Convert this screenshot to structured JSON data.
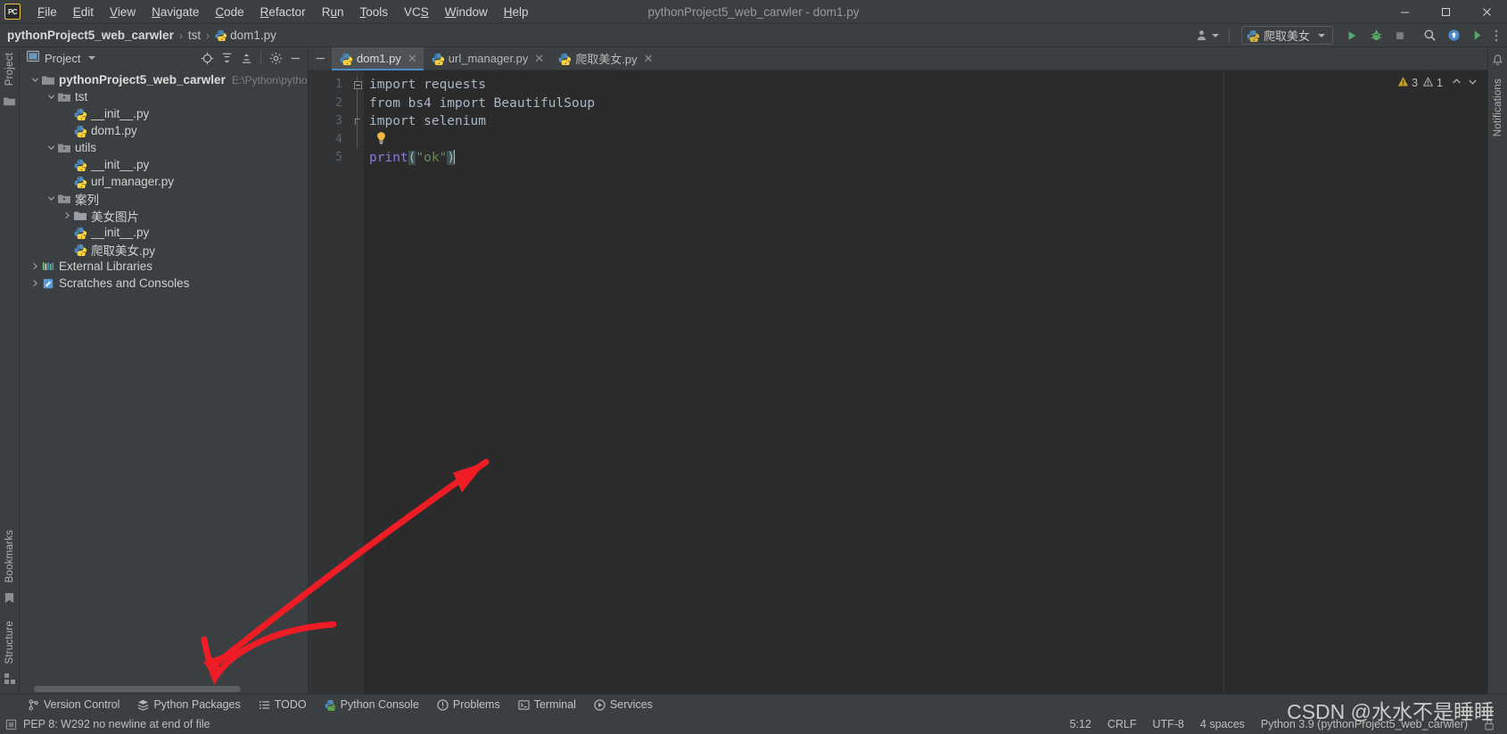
{
  "window": {
    "title": "pythonProject5_web_carwler - dom1.py",
    "app_logo": "pycharm-logo",
    "controls": {
      "minimize": "—",
      "maximize": "☐",
      "close": "✕"
    }
  },
  "menu": {
    "items": [
      {
        "label": "File",
        "mnemonic": "F"
      },
      {
        "label": "Edit",
        "mnemonic": "E"
      },
      {
        "label": "View",
        "mnemonic": "V"
      },
      {
        "label": "Navigate",
        "mnemonic": "N"
      },
      {
        "label": "Code",
        "mnemonic": "C"
      },
      {
        "label": "Refactor",
        "mnemonic": "R"
      },
      {
        "label": "Run",
        "mnemonic": "u"
      },
      {
        "label": "Tools",
        "mnemonic": "T"
      },
      {
        "label": "VCS",
        "mnemonic": "S"
      },
      {
        "label": "Window",
        "mnemonic": "W"
      },
      {
        "label": "Help",
        "mnemonic": "H"
      }
    ]
  },
  "breadcrumb": {
    "project": "pythonProject5_web_carwler",
    "folder": "tst",
    "file": "dom1.py",
    "separator": "›"
  },
  "toolbar": {
    "run_config": "爬取美女",
    "buttons": [
      {
        "name": "user-avatar-button",
        "tip": "Settings Sync"
      },
      {
        "name": "run-button",
        "tip": "Run"
      },
      {
        "name": "debug-button",
        "tip": "Debug"
      },
      {
        "name": "stop-button",
        "tip": "Stop"
      },
      {
        "name": "search-everywhere-button",
        "tip": "Search Everywhere"
      },
      {
        "name": "updates-button",
        "tip": "IDE Updates"
      },
      {
        "name": "hide-toolbar-button",
        "tip": "More"
      }
    ]
  },
  "left_rail": {
    "top_label": "Project",
    "bottom_labels": [
      "Bookmarks",
      "Structure"
    ]
  },
  "right_rail": {
    "label": "Notifications"
  },
  "project_panel": {
    "title": "Project",
    "tools": [
      "target-icon",
      "expand-all-icon",
      "collapse-all-icon",
      "gear-icon",
      "hide-icon"
    ],
    "tree": [
      {
        "depth": 0,
        "arrow": "down",
        "icon": "folder-project",
        "label": "pythonProject5_web_carwler",
        "bold": true,
        "path": "E:\\Python\\pythonPr"
      },
      {
        "depth": 1,
        "arrow": "down",
        "icon": "folder-source",
        "label": "tst",
        "bold": false,
        "path": ""
      },
      {
        "depth": 2,
        "arrow": "none",
        "icon": "python-file",
        "label": "__init__.py",
        "bold": false,
        "path": ""
      },
      {
        "depth": 2,
        "arrow": "none",
        "icon": "python-file",
        "label": "dom1.py",
        "bold": false,
        "path": ""
      },
      {
        "depth": 1,
        "arrow": "down",
        "icon": "folder-source",
        "label": "utils",
        "bold": false,
        "path": ""
      },
      {
        "depth": 2,
        "arrow": "none",
        "icon": "python-file",
        "label": "__init__.py",
        "bold": false,
        "path": ""
      },
      {
        "depth": 2,
        "arrow": "none",
        "icon": "python-file",
        "label": "url_manager.py",
        "bold": false,
        "path": ""
      },
      {
        "depth": 1,
        "arrow": "down",
        "icon": "folder-source",
        "label": "案列",
        "bold": false,
        "path": ""
      },
      {
        "depth": 2,
        "arrow": "right",
        "icon": "folder-plain",
        "label": "美女图片",
        "bold": false,
        "path": ""
      },
      {
        "depth": 2,
        "arrow": "none",
        "icon": "python-file",
        "label": "__init__.py",
        "bold": false,
        "path": ""
      },
      {
        "depth": 2,
        "arrow": "none",
        "icon": "python-file",
        "label": "爬取美女.py",
        "bold": false,
        "path": ""
      },
      {
        "depth": 0,
        "arrow": "right",
        "icon": "libraries",
        "label": "External Libraries",
        "bold": false,
        "path": ""
      },
      {
        "depth": 0,
        "arrow": "right",
        "icon": "scratches",
        "label": "Scratches and Consoles",
        "bold": false,
        "path": ""
      }
    ]
  },
  "editor": {
    "tabs": [
      {
        "label": "dom1.py",
        "active": true,
        "icon": "python-file",
        "close": "✕"
      },
      {
        "label": "url_manager.py",
        "active": false,
        "icon": "python-file",
        "close": "✕"
      },
      {
        "label": "爬取美女.py",
        "active": false,
        "icon": "python-file",
        "close": "✕"
      }
    ],
    "line_numbers": [
      "1",
      "2",
      "3",
      "4",
      "5"
    ],
    "lines": [
      {
        "n": 1,
        "fold": "collapse",
        "tokens": [
          {
            "t": "import requests",
            "c": "plain"
          }
        ]
      },
      {
        "n": 2,
        "fold": "none",
        "tokens": [
          {
            "t": "from bs4 import BeautifulSoup",
            "c": "plain"
          }
        ]
      },
      {
        "n": 3,
        "fold": "end",
        "tokens": [
          {
            "t": "import selenium",
            "c": "plain"
          }
        ]
      },
      {
        "n": 4,
        "fold": "none",
        "tokens": []
      },
      {
        "n": 5,
        "fold": "none",
        "tokens": [
          {
            "t": "print",
            "c": "fn"
          },
          {
            "t": "(",
            "c": "bracket"
          },
          {
            "t": "\"ok\"",
            "c": "str"
          },
          {
            "t": ")",
            "c": "bracket"
          }
        ]
      }
    ],
    "line4_hint": "lightbulb-intention-icon",
    "inspections": {
      "warnings": "3",
      "weak_warnings": "1",
      "warn_icon": "warning-triangle",
      "weak_icon": "warning-triangle-small"
    }
  },
  "bottom_tools": [
    {
      "label": "Version Control",
      "icon": "branch-icon"
    },
    {
      "label": "Python Packages",
      "icon": "packages-icon"
    },
    {
      "label": "TODO",
      "icon": "list-icon"
    },
    {
      "label": "Python Console",
      "icon": "python-icon"
    },
    {
      "label": "Problems",
      "icon": "exclamation-icon"
    },
    {
      "label": "Terminal",
      "icon": "terminal-icon"
    },
    {
      "label": "Services",
      "icon": "play-circle-icon"
    }
  ],
  "statusbar": {
    "message": "PEP 8: W292 no newline at end of file",
    "message_icon": "inspection-icon",
    "caret_position": "5:12",
    "line_separator": "CRLF",
    "encoding": "UTF-8",
    "indent": "4 spaces",
    "interpreter": "Python 3.9 (pythonProject5_web_carwler)",
    "lock_icon": "lock-icon"
  },
  "watermark": "CSDN @水水不是睡睡",
  "colors": {
    "bg_panel": "#3c3f41",
    "bg_editor": "#2b2b2b",
    "accent_tab": "#4a88c7",
    "string_green": "#6a8759",
    "function_purple": "#8a7cdd",
    "annotation_red": "#ee1c25",
    "warning_yellow": "#c9a227"
  }
}
